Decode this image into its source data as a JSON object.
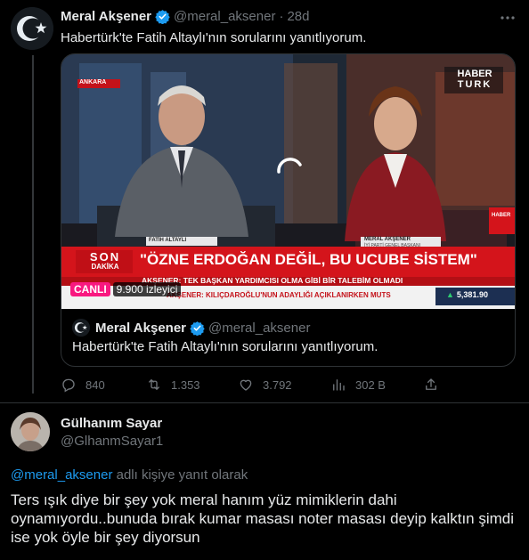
{
  "tweet": {
    "author_name": "Meral Akşener",
    "author_handle": "@meral_aksener",
    "separator": "·",
    "time": "28d",
    "text": "Habertürk'te Fatih Altaylı'nın sorularını yanıtlıyorum."
  },
  "video": {
    "channel_logo_line1": "HABER",
    "channel_logo_line2": "TURK",
    "location": "ANKARA",
    "guest_name": "FATİH ALTAYLI",
    "host_name": "MERAL AKŞENER",
    "host_title": "İYİ PARTİ GENEL BAŞKANI",
    "breaking_line1": "SON",
    "breaking_line2": "DAKİKA",
    "headline": "\"ÖZNE ERDOĞAN DEĞİL, BU UCUBE SİSTEM\"",
    "subheadline": "AKŞENER: TEK BAŞKAN YARDIMCISI OLMA GİBİ BİR TALEBİM OLMADI",
    "ticker": "AKŞENER: KILIÇDAROĞLU'NUN ADAYLIĞI AÇIKLANIRKEN MUTS",
    "market_value": "5,381.90",
    "live_label": "CANLI",
    "viewers": "9.900 izleyici",
    "side_logo": "HABER"
  },
  "quote": {
    "author_name": "Meral Akşener",
    "author_handle": "@meral_aksener",
    "text": "Habertürk'te Fatih Altaylı'nın sorularını yanıtlıyorum."
  },
  "actions": {
    "replies": "840",
    "retweets": "1.353",
    "likes": "3.792",
    "views": "302 B"
  },
  "reply": {
    "author_name": "Gülhanım Sayar",
    "author_handle": "@GlhanmSayar1",
    "reply_to_handle": "@meral_aksener",
    "reply_to_suffix": " adlı kişiye yanıt olarak",
    "text": "Ters ışık diye bir şey yok meral hanım yüz mimiklerin dahi oynamıyordu..bunuda bırak kumar masası noter masası deyip kalktın şimdi ise yok öyle bir şey diyorsun"
  },
  "colors": {
    "accent": "#1d9bf0",
    "muted": "#71767b",
    "live": "#f91880",
    "breaking_red": "#d4141b"
  }
}
